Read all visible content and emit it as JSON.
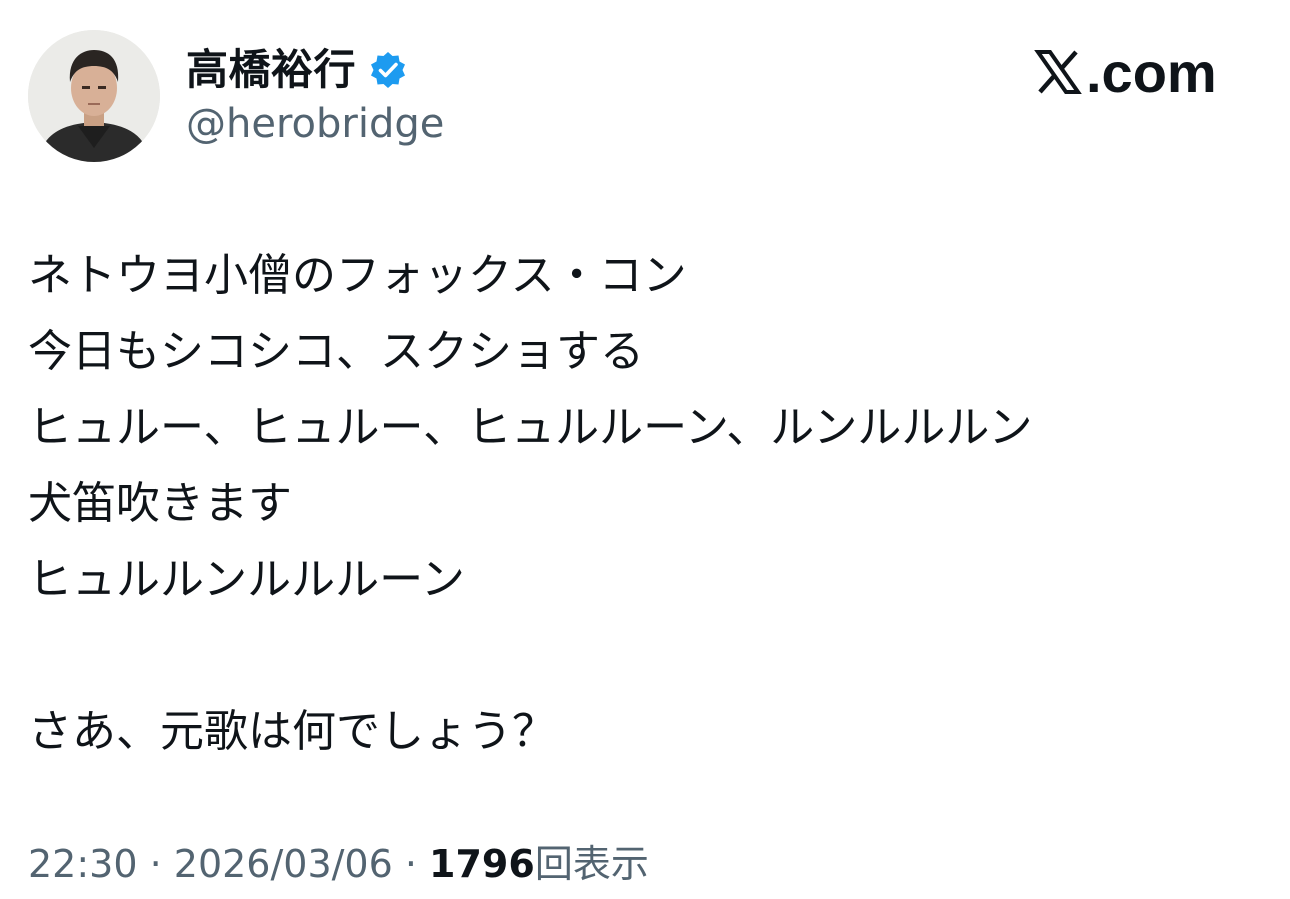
{
  "author": {
    "display_name": "高橋裕行",
    "handle": "@herobridge",
    "verified": true
  },
  "brand": {
    "label": ".com",
    "icon": "x-logo-icon"
  },
  "tweet": {
    "lines": [
      "ネトウヨ小僧のフォックス・コン",
      "今日もシコシコ、スクショする",
      "ヒュルー、ヒュルー、ヒュルルーン、ルンルルルン",
      "犬笛吹きます",
      "ヒュルルンルルルーン",
      "",
      "さあ、元歌は何でしょう？"
    ]
  },
  "meta": {
    "time": "22:30",
    "separator": " · ",
    "date": "2026/03/06",
    "views_count": "1796",
    "views_label": "回表示"
  },
  "colors": {
    "text": "#0f1419",
    "secondary": "#536471",
    "verified": "#1d9bf0"
  }
}
